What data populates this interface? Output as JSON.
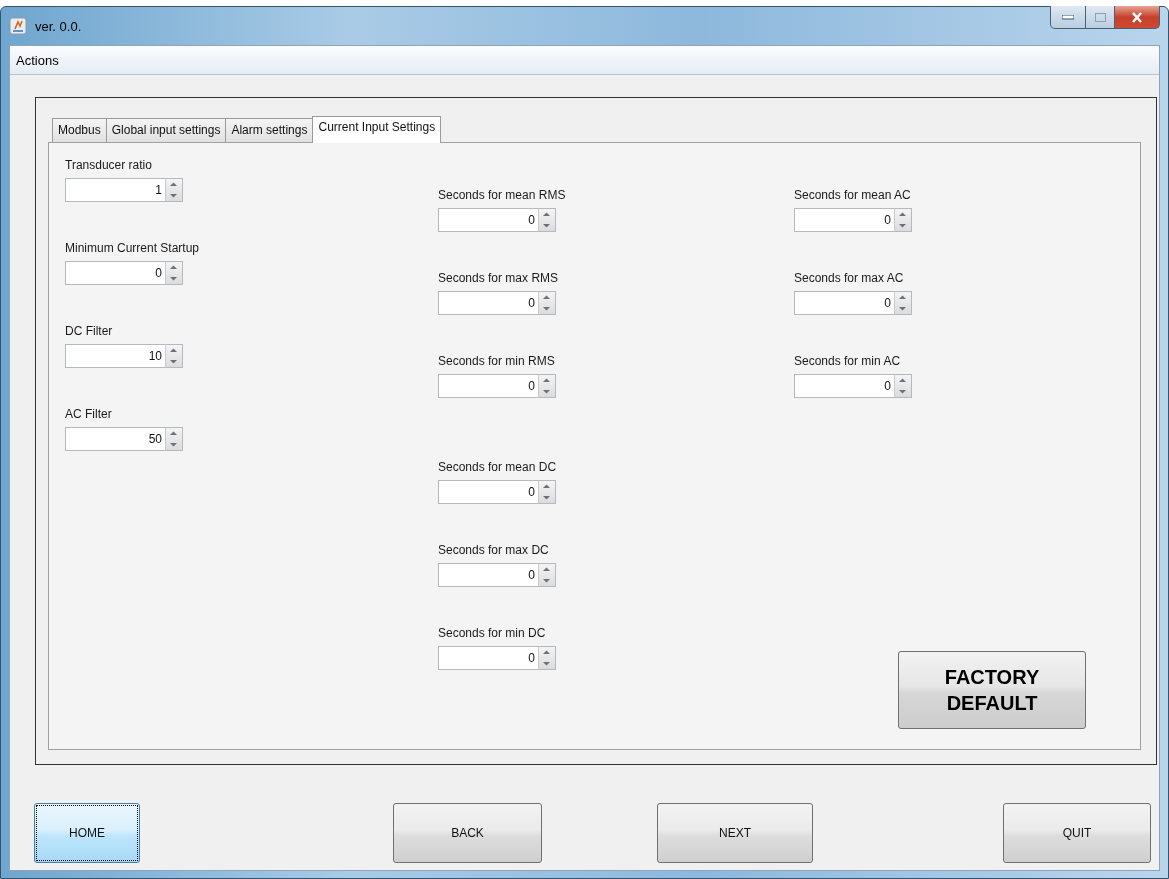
{
  "window": {
    "title": "ver. 0.0."
  },
  "menu": [
    "Actions"
  ],
  "tabs": [
    {
      "label": "Modbus",
      "selected": false
    },
    {
      "label": "Global input settings",
      "selected": false
    },
    {
      "label": "Alarm settings",
      "selected": false
    },
    {
      "label": "Current Input Settings",
      "selected": true
    }
  ],
  "columns": [
    {
      "groups": [
        [
          {
            "label": "Transducer ratio",
            "value": "1"
          },
          {
            "label": "Minimum Current Startup",
            "value": "0"
          },
          {
            "label": "DC Filter",
            "value": "10"
          },
          {
            "label": "AC Filter",
            "value": "50"
          }
        ]
      ]
    },
    {
      "groups": [
        [
          {
            "label": "Seconds for mean RMS",
            "value": "0"
          },
          {
            "label": "Seconds for max RMS",
            "value": "0"
          },
          {
            "label": "Seconds for min RMS",
            "value": "0"
          }
        ],
        [
          {
            "label": "Seconds for mean DC",
            "value": "0"
          },
          {
            "label": "Seconds for max DC",
            "value": "0"
          },
          {
            "label": "Seconds for min DC",
            "value": "0"
          }
        ]
      ]
    },
    {
      "groups": [
        [
          {
            "label": "Seconds for mean AC",
            "value": "0"
          },
          {
            "label": "Seconds for max AC",
            "value": "0"
          },
          {
            "label": "Seconds for min AC",
            "value": "0"
          }
        ]
      ]
    }
  ],
  "factory_default_button": "FACTORY DEFAULT",
  "buttons": [
    {
      "label": "HOME",
      "focused": true
    },
    {
      "label": "BACK",
      "focused": false
    },
    {
      "label": "NEXT",
      "focused": false
    },
    {
      "label": "QUIT",
      "focused": false
    }
  ]
}
